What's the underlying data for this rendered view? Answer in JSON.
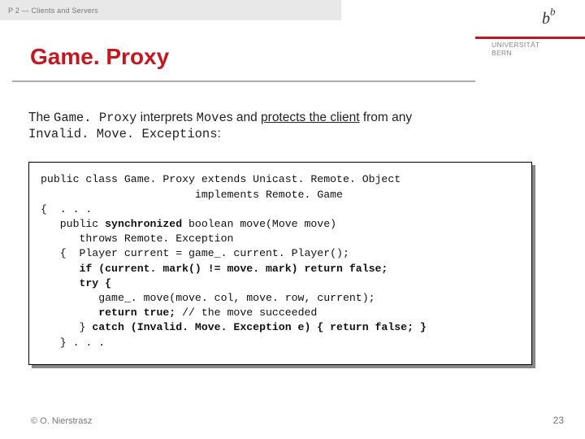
{
  "breadcrumb": "P 2 — Clients and Servers",
  "logo": {
    "letter": "b",
    "uni1": "UNIVERSITÄT",
    "uni2": "BERN"
  },
  "title": "Game. Proxy",
  "intro": {
    "t1": "The ",
    "m1": "Game. Proxy",
    "t2": " interprets ",
    "m2": "Move",
    "t3": "s and ",
    "u1": "protects the client",
    "t4": " from any ",
    "m3": "Invalid. Move. Exceptions",
    "t5": ":"
  },
  "code": {
    "l1": "public class Game. Proxy extends Unicast. Remote. Object",
    "l2": "                        implements Remote. Game",
    "l3": "{  . . .",
    "l4a": "   public ",
    "l4b": "synchronized",
    "l4c": " boolean move(Move move)",
    "l5": "      throws Remote. Exception",
    "l6": "   {  Player current = game_. current. Player();",
    "l7a": "      ",
    "l7b": "if (current. mark() != move. mark) return false;",
    "l8a": "      ",
    "l8b": "try {",
    "l9": "         game_. move(move. col, move. row, current);",
    "l10a": "         ",
    "l10b": "return true;",
    "l10c": " // the move succeeded",
    "l11a": "      } ",
    "l11b": "catch (Invalid. Move. Exception e) { return false; }",
    "l12": "   } . . ."
  },
  "footer": {
    "left": "© O. Nierstrasz",
    "right": "23"
  }
}
